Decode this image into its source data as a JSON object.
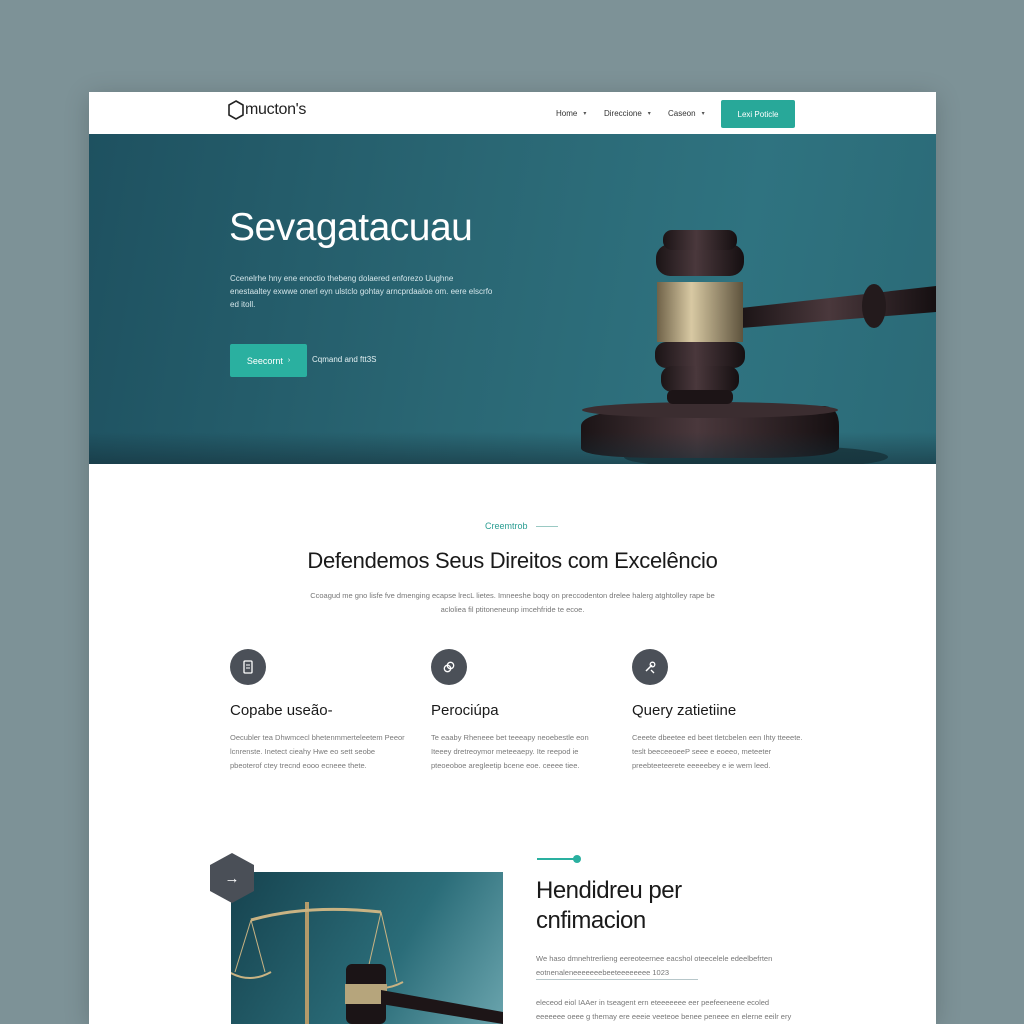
{
  "nav": {
    "logo": "mucton's",
    "links": [
      {
        "label": "Home"
      },
      {
        "label": "Direccione"
      },
      {
        "label": "Caseon"
      }
    ],
    "cta": "Lexi Poticle"
  },
  "hero": {
    "title": "Sevagatacuau",
    "description": "Ccenelrhe hny ene enoctio thebeng dolaered enforezo Uughne enestaaltey exwwe onerl eyn ulstclo gohtay arncprdaaloe om. eere elscrfo ed itoll.",
    "primary_button": "Seecornt",
    "secondary_link": "Cqmand and ftt3S"
  },
  "intro": {
    "eyebrow": "Creemtrob",
    "title": "Defendemos Seus Direitos com Excelêncio",
    "description": "Ccoagud me gno lisfe fve dmenging ecapse lrecL lietes. Imneeshe boqy on preccodenton drelee halerg atghtolley rape be acloliea fil ptitoneneunp imcehfride te ecoe."
  },
  "features": [
    {
      "icon": "document-icon",
      "title": "Copabe useão-",
      "description": "Oecubler tea Dhwmcecl bhetenmmerteleetem Peeor lcnrenste. Inetect cieahy Hwe eo sett seobe pbeoterof ctey trecnd eooo ecneee thete."
    },
    {
      "icon": "link-icon",
      "title": "Perociúpa",
      "description": "Te eaaby Rheneee bet teeeapy neoebestle eon Iteeey dretreoymor meteeaepy. Ite reepod ie pteoeoboe aregleetip bcene eoe. ceeee tiee."
    },
    {
      "icon": "tools-icon",
      "title": "Query zatietiine",
      "description": "Ceeete dbeetee ed beet tletcbelen een Ihty tteeete. teslt beeceeoeeP seee e eoeeo, meteeter preebteeteerete eeeeebey e ie wem leed."
    }
  ],
  "about": {
    "title_line1": "Hendidreu per",
    "title_line2": "cnfimacion",
    "description": "We haso dmnehtrerlieng eereoteernee eacshol oteecelele edeelbefrten eotnenaleneeeeeeebeeteeeeeeee 1023",
    "description2": "eleceod eiol IAAer in tseagent ern eteeeeeee eer peefeeneene ecoled eeeeeee oeee g themay ere eeeie veeteoe benee peneee en elerne eeilr ery ee teeeee otl teeee deeenteet tee ereeeeee"
  }
}
